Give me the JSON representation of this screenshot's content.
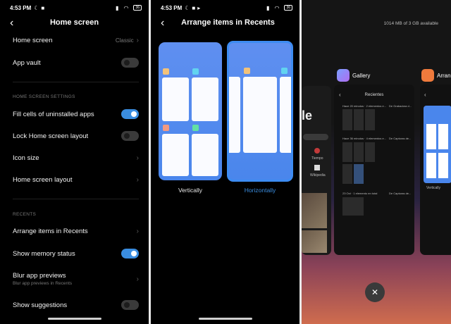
{
  "colors": {
    "accent": "#3a8de0",
    "preview_blue": "#4a86ec"
  },
  "status": {
    "time": "4:53 PM",
    "battery": "36"
  },
  "home_screen": {
    "title": "Home screen",
    "rows": {
      "home_screen": {
        "label": "Home screen",
        "value": "Classic"
      },
      "app_vault": {
        "label": "App vault",
        "toggle": "off"
      },
      "fill_cells": {
        "label": "Fill cells of uninstalled apps",
        "toggle": "on"
      },
      "lock_layout": {
        "label": "Lock Home screen layout",
        "toggle": "off"
      },
      "icon_size": {
        "label": "Icon size"
      },
      "layout": {
        "label": "Home screen layout"
      },
      "arrange": {
        "label": "Arrange items in Recents"
      },
      "memory": {
        "label": "Show memory status",
        "toggle": "on"
      },
      "blur": {
        "label": "Blur app previews",
        "sub": "Blur app previews in Recents"
      },
      "suggestions": {
        "label": "Show suggestions",
        "toggle": "off"
      }
    },
    "sections": {
      "settings": "HOME SCREEN SETTINGS",
      "recents": "RECENTS"
    }
  },
  "arrange": {
    "title": "Arrange items in Recents",
    "options": {
      "vertical": "Vertically",
      "horizontal": "Horizontally"
    }
  },
  "recents": {
    "memory": "1014 MB of 3 GB available",
    "apps": {
      "gallery": "Gallery",
      "arrange": "Arrang"
    },
    "gallery_header": "Recientes",
    "gallery_rows": [
      "Hace 20 minutos · 2 elementos e...",
      "Hace 36 minutos · 4 elementos e...",
      "23 Oct · 1 elemento en total"
    ],
    "gallery_tags": [
      "De Grabadora d...",
      "De Capturas de...",
      "De Capturas de..."
    ],
    "arrange_preview_label": "Vertically",
    "left_app": {
      "partial_text": "le",
      "items": [
        "Tiempo",
        "Wikipedia"
      ]
    }
  }
}
